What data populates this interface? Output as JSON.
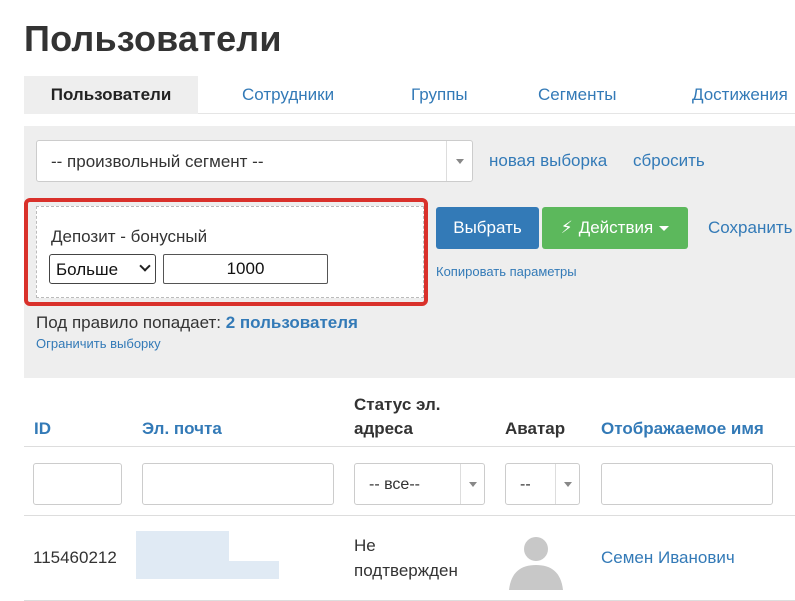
{
  "page": {
    "title": "Пользователи"
  },
  "tabs": [
    {
      "label": "Пользователи",
      "active": true
    },
    {
      "label": "Сотрудники",
      "active": false
    },
    {
      "label": "Группы",
      "active": false
    },
    {
      "label": "Сегменты",
      "active": false
    },
    {
      "label": "Достижения",
      "active": false
    }
  ],
  "segment": {
    "select_value": "-- произвольный сегмент --",
    "new_selection_link": "новая выборка",
    "reset_link": "сбросить"
  },
  "rule": {
    "label": "Депозит - бонусный",
    "operator": "Больше",
    "value": "1000"
  },
  "actions": {
    "select_button": "Выбрать",
    "actions_button": "Действия",
    "save_link": "Сохранить",
    "copy_params_link": "Копировать параметры"
  },
  "result": {
    "prefix": "Под правило попадает:",
    "count_text": "2 пользователя",
    "limit_link": "Ограничить выборку"
  },
  "table": {
    "headers": {
      "id": "ID",
      "email": "Эл. почта",
      "email_status_line1": "Статус эл.",
      "email_status_line2": "адреса",
      "avatar": "Аватар",
      "display_name": "Отображаемое имя"
    },
    "filters": {
      "status_all": "-- все--",
      "avatar_any": "--"
    },
    "rows": [
      {
        "id": "115460212",
        "status_line1": "Не",
        "status_line2": "подтвержден",
        "display_name": "Семен Иванович"
      }
    ]
  },
  "colors": {
    "link": "#337ab7",
    "primary_button": "#337ab7",
    "success_button": "#5cb85c",
    "highlight_border": "#d9312b",
    "panel_bg": "#eeeeee"
  },
  "icons": {
    "select_caret": "caret-down-icon",
    "actions": "lightning-bolt-icon",
    "avatar": "user-silhouette-icon"
  }
}
